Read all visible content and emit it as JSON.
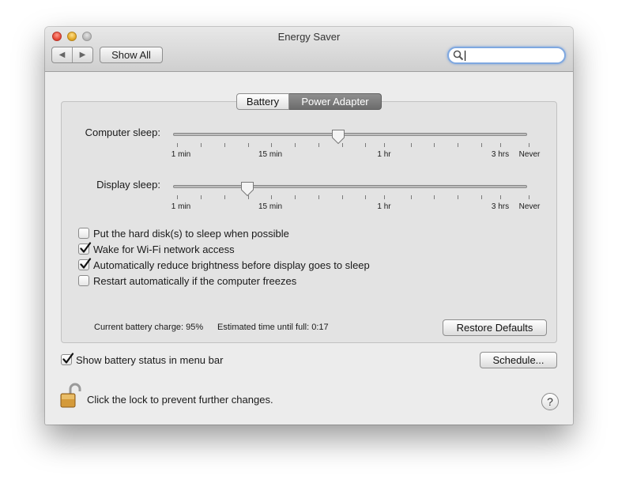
{
  "window": {
    "title": "Energy Saver"
  },
  "toolbar": {
    "show_all_label": "Show All",
    "back_glyph": "◀",
    "forward_glyph": "▶",
    "search_placeholder": ""
  },
  "tabs": [
    {
      "label": "Battery",
      "selected": false
    },
    {
      "label": "Power Adapter",
      "selected": true
    }
  ],
  "computer_sleep": {
    "label": "Computer sleep:",
    "value": "the slider thumb sits between 15 min and 1 hr",
    "tick_labels": [
      "1 min",
      "15 min",
      "1 hr",
      "3 hrs",
      "Never"
    ]
  },
  "display_sleep": {
    "label": "Display sleep:",
    "value": "the slider thumb sits near 15 min",
    "tick_labels": [
      "1 min",
      "15 min",
      "1 hr",
      "3 hrs",
      "Never"
    ]
  },
  "options": [
    {
      "label": "Put the hard disk(s) to sleep when possible",
      "checked": false
    },
    {
      "label": "Wake for Wi-Fi network access",
      "checked": true
    },
    {
      "label": "Automatically reduce brightness before display goes to sleep",
      "checked": true
    },
    {
      "label": "Restart automatically if the computer freezes",
      "checked": false
    }
  ],
  "status": {
    "battery_charge": "Current battery charge: 95%",
    "time_until_full": "Estimated time until full: 0:17"
  },
  "buttons": {
    "restore_defaults": "Restore Defaults",
    "schedule": "Schedule..."
  },
  "menu_bar_option": {
    "label": "Show battery status in menu bar",
    "checked": true
  },
  "lock": {
    "text": "Click the lock to prevent further changes."
  },
  "help": {
    "glyph": "?"
  }
}
